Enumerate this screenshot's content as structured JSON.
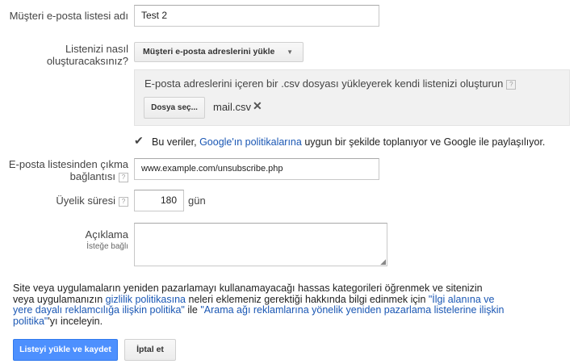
{
  "form": {
    "list_name_label": "Müşteri e-posta listesi adı",
    "list_name_value": "Test 2",
    "how_label_1": "Listenizi nasıl",
    "how_label_2": "oluşturacaksınız?",
    "how_select_value": "Müşteri e-posta adreslerini yükle",
    "upload_hint": "E-posta adreslerini içeren bir .csv dosyası yükleyerek kendi listenizi oluşturun",
    "choose_file_label": "Dosya seç...",
    "file_name": "mail.csv",
    "consent_text_1": "Bu veriler, ",
    "consent_link": "Google'ın politikalarına",
    "consent_text_2": " uygun bir şekilde toplanıyor ve Google ile paylaşılıyor.",
    "unsub_label_1": "E-posta listesinden çıkma",
    "unsub_label_2": "bağlantısı",
    "unsub_value": "www.example.com/unsubscribe.php",
    "duration_label": "Üyelik süresi",
    "duration_value": "180",
    "duration_unit": "gün",
    "desc_label": "Açıklama",
    "desc_sub": "İsteğe bağlı",
    "help_glyph": "?"
  },
  "notice": {
    "t1": "Site veya uygulamaların yeniden pazarlamayı kullanamayacağı hassas kategorileri öğrenmek ve sitenizin veya uygulamanızın ",
    "l1": "gizlilik politikasına",
    "t2": " neleri eklemeniz gerektiği hakkında bilgi edinmek için ",
    "l2": "\"İlgi alanına ve yere dayalı reklamcılığa ilişkin politika\"",
    "t3": " ile ",
    "l3": "\"Arama ağı reklamlarına yönelik yeniden pazarlama listelerine ilişkin politika\"",
    "t4": "'yı inceleyin."
  },
  "actions": {
    "submit_label": "Listeyi yükle ve kaydet",
    "cancel_label": "İptal et"
  },
  "colors": {
    "primary": "#4d90fe",
    "link": "#1a57b4"
  },
  "icons": [
    "help-icon",
    "dropdown-arrow-icon",
    "remove-file-icon",
    "checkbox-checked-icon",
    "resize-handle-icon"
  ]
}
